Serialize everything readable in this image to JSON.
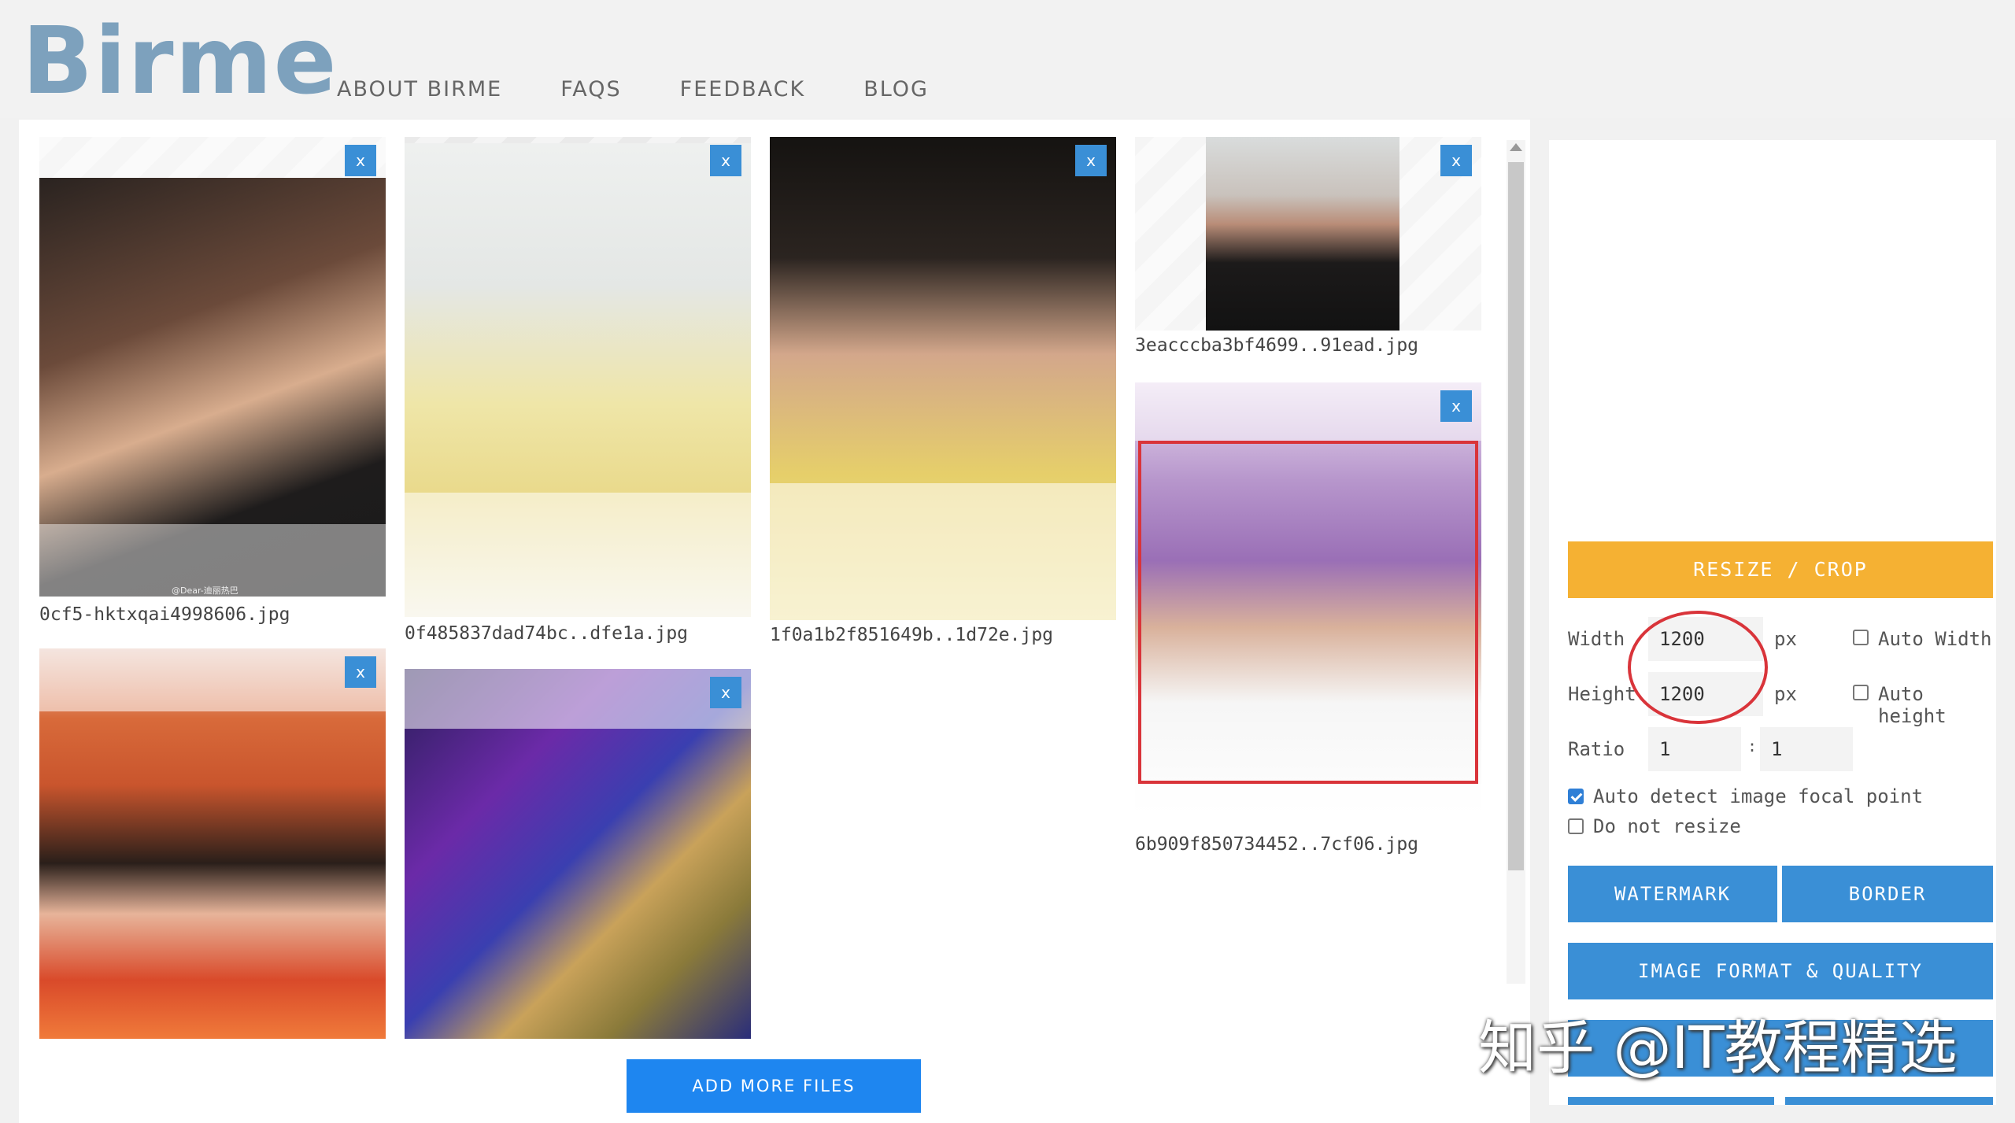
{
  "header": {
    "logo": "Birme",
    "nav": [
      "ABOUT BIRME",
      "FAQS",
      "FEEDBACK",
      "BLOG"
    ]
  },
  "images": [
    {
      "filename": "0cf5-hktxqai4998606.jpg",
      "photo_caption": "@Dear-迪丽热巴"
    },
    {
      "filename": "0f485837dad74bc..dfe1a.jpg"
    },
    {
      "filename": "1f0a1b2f851649b..1d72e.jpg"
    },
    {
      "filename": "3eacccba3bf4699..91ead.jpg"
    },
    {
      "filename": "6b909f850734452..7cf06.jpg"
    },
    {
      "filename": ""
    },
    {
      "filename": ""
    }
  ],
  "close_label": "x",
  "add_more_label": "ADD MORE FILES",
  "panel": {
    "resize_label": "RESIZE / CROP",
    "width_label": "Width",
    "width_value": "1200",
    "height_label": "Height",
    "height_value": "1200",
    "unit": "px",
    "auto_width_label": "Auto Width",
    "auto_height_label": "Auto height",
    "ratio_label": "Ratio",
    "ratio_w": "1",
    "ratio_h": "1",
    "ratio_sep": ":",
    "auto_focal_label": "Auto detect image focal point",
    "auto_focal_checked": true,
    "no_resize_label": "Do not resize",
    "watermark_label": "WATERMARK",
    "border_label": "BORDER",
    "format_label": "IMAGE FORMAT & QUALITY"
  },
  "overlay_watermark": "知乎 @IT教程精选",
  "colors": {
    "accent_blue": "#3a8fd6",
    "add_more_blue": "#1e86f0",
    "resize_orange": "#f5b133",
    "annotation_red": "#d9343a",
    "logo": "#7da1bd"
  }
}
